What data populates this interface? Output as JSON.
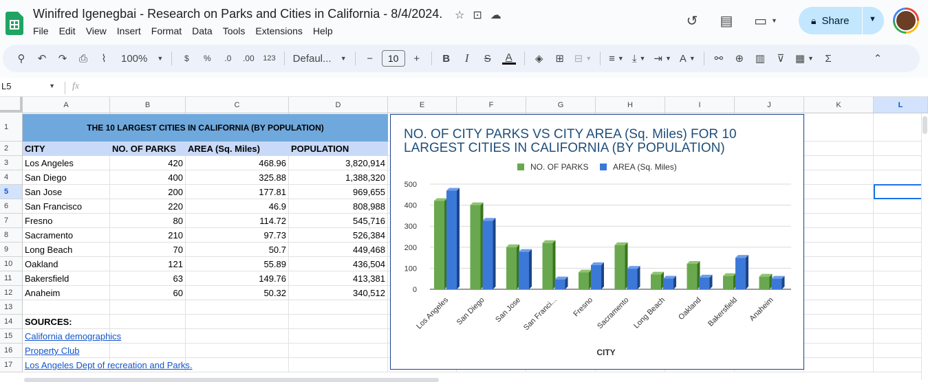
{
  "app": {
    "title": "Winifred Igenegbai - Research on Parks and Cities in California - 8/4/2024.",
    "menus": [
      "File",
      "Edit",
      "View",
      "Insert",
      "Format",
      "Data",
      "Tools",
      "Extensions",
      "Help"
    ],
    "share_label": "Share",
    "icons": [
      "star-icon",
      "move-icon",
      "cloud-icon",
      "history-icon",
      "comment-icon",
      "meet-icon",
      "lock-icon"
    ]
  },
  "toolbar": {
    "zoom": "100%",
    "currency": "$",
    "percent": "%",
    "dec_decrease": ".0",
    "dec_increase": ".00",
    "number_format": "123",
    "font": "Defaul...",
    "font_size": "10",
    "minus": "−",
    "plus": "+",
    "bold": "B",
    "italic": "I",
    "strike": "S",
    "text_color": "A"
  },
  "formula": {
    "cell_ref": "L5",
    "fx": "fx",
    "value": ""
  },
  "columns": [
    "A",
    "B",
    "C",
    "D",
    "E",
    "F",
    "G",
    "H",
    "I",
    "J",
    "K",
    "L"
  ],
  "rows": [
    "1",
    "2",
    "3",
    "4",
    "5",
    "6",
    "7",
    "8",
    "9",
    "10",
    "11",
    "12",
    "13",
    "14",
    "15",
    "16",
    "17"
  ],
  "sheet": {
    "title": "THE 10 LARGEST CITIES IN CALIFORNIA (BY POPULATION)",
    "headers": [
      "CITY",
      "NO. OF PARKS",
      "AREA (Sq. Miles)",
      "POPULATION"
    ],
    "data": [
      [
        "Los Angeles",
        "420",
        "468.96",
        "3,820,914"
      ],
      [
        "San Diego",
        "400",
        "325.88",
        "1,388,320"
      ],
      [
        "San Jose",
        "200",
        "177.81",
        "969,655"
      ],
      [
        "San Francisco",
        "220",
        "46.9",
        "808,988"
      ],
      [
        "Fresno",
        "80",
        "114.72",
        "545,716"
      ],
      [
        "Sacramento",
        "210",
        "97.73",
        "526,384"
      ],
      [
        "Long Beach",
        "70",
        "50.7",
        "449,468"
      ],
      [
        "Oakland",
        "121",
        "55.89",
        "436,504"
      ],
      [
        "Bakersfield",
        "63",
        "149.76",
        "413,381"
      ],
      [
        "Anaheim",
        "60",
        "50.32",
        "340,512"
      ]
    ],
    "sources_label": "SOURCES:",
    "sources": [
      "California demographics",
      "Property Club",
      "Los Angeles Dept of recreation and Parks."
    ]
  },
  "colors": {
    "title_fill": "#6fa8dc",
    "header_fill": "#c9daf8",
    "parks_series": "#6aa84f",
    "area_series": "#3c78d8",
    "share_button": "#c2e7ff"
  },
  "chart_data": {
    "type": "bar",
    "title": "NO. OF CITY PARKS VS CITY AREA (Sq. Miles) FOR 10 LARGEST CITIES IN CALIFORNIA (BY POPULATION)",
    "title_lines": [
      "NO. OF CITY PARKS VS CITY AREA (Sq. Miles) FOR 10",
      "LARGEST CITIES IN CALIFORNIA (BY POPULATION)"
    ],
    "categories": [
      "Los Angeles",
      "San Diego",
      "San Jose",
      "San Franci...",
      "Fresno",
      "Sacramento",
      "Long Beach",
      "Oakland",
      "Bakersfield",
      "Anaheim"
    ],
    "series": [
      {
        "name": "NO. OF PARKS",
        "color": "#6aa84f",
        "values": [
          420,
          400,
          200,
          220,
          80,
          210,
          70,
          121,
          63,
          60
        ]
      },
      {
        "name": "AREA (Sq. Miles)",
        "color": "#3c78d8",
        "values": [
          468.96,
          325.88,
          177.81,
          46.9,
          114.72,
          97.73,
          50.7,
          55.89,
          149.76,
          50.32
        ]
      }
    ],
    "xlabel": "CITY",
    "ylabel": "",
    "ylim": [
      0,
      500
    ],
    "yticks": [
      "0",
      "100",
      "200",
      "300",
      "400",
      "500"
    ],
    "grid": true,
    "legend": "top"
  }
}
